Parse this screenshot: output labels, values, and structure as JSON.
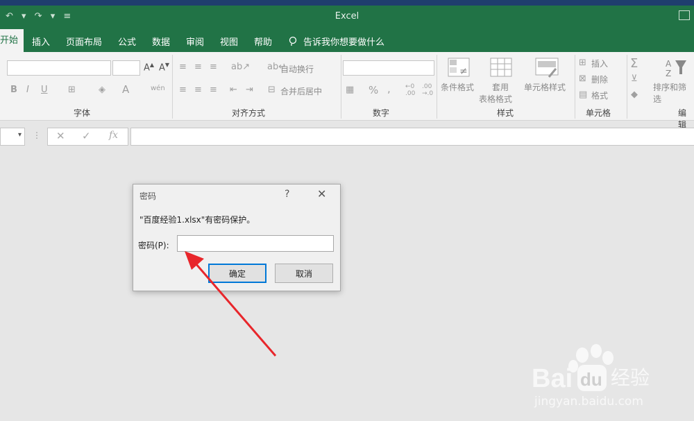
{
  "title_bar": {
    "app_title": "Excel",
    "qat_text": "↶ ▾ ↷ ▾ ≡"
  },
  "tabs": [
    "开始",
    "插入",
    "页面布局",
    "公式",
    "数据",
    "审阅",
    "视图",
    "帮助"
  ],
  "tell_me": "告诉我你想要做什么",
  "ribbon": {
    "font_group_label": "字体",
    "align_group_label": "对齐方式",
    "number_group_label": "数字",
    "styles_group_label": "样式",
    "cells_group_label": "单元格",
    "editing_group_label": "编辑",
    "wrap_text": "自动换行",
    "merge_center": "合并后居中",
    "conditional_format": "条件格式",
    "format_table_1": "套用",
    "format_table_2": "表格格式",
    "cell_styles": "单元格样式",
    "insert": "插入",
    "delete": "删除",
    "format": "格式",
    "sort_filter": "排序和筛选"
  },
  "dialog": {
    "title": "密码",
    "help": "?",
    "close": "✕",
    "message": "\"百度经验1.xlsx\"有密码保护。",
    "password_label": "密码(P):",
    "password_value": "",
    "ok_label": "确定",
    "cancel_label": "取消"
  },
  "watermark": {
    "brand": "Bai du 经验",
    "url": "jingyan.baidu.com"
  },
  "colors": {
    "excel_green": "#217346",
    "arrow_red": "#e8262b",
    "focus_blue": "#0078d7"
  }
}
